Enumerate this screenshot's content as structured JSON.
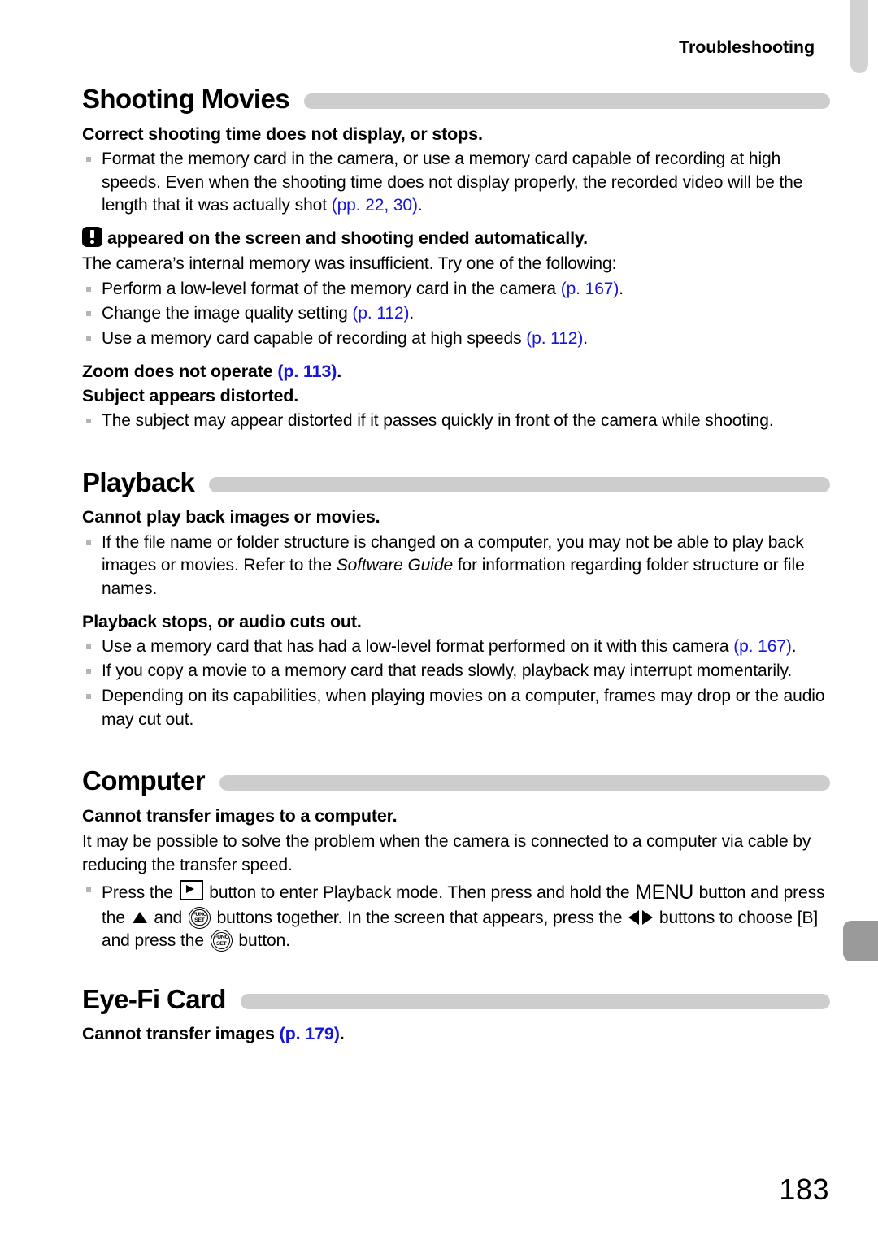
{
  "page": {
    "running_header": "Troubleshooting",
    "page_number": "183"
  },
  "sections": [
    {
      "title": "Shooting Movies",
      "blocks": [
        {
          "kind": "subhead",
          "text": "Correct shooting time does not display, or stops."
        },
        {
          "kind": "bullet",
          "text_before": "Format the memory card in the camera, or use a memory card capable of recording at high speeds. Even when the shooting time does not display properly, the recorded video will be the length that it was actually shot ",
          "ref": "(pp. 22, 30)",
          "text_after": "."
        },
        {
          "kind": "subhead_icon",
          "icon": "warning-icon",
          "text": "appeared on the screen and shooting ended automatically."
        },
        {
          "kind": "para",
          "text": "The camera’s internal memory was insufficient. Try one of the following:"
        },
        {
          "kind": "bullet",
          "text_before": "Perform a low-level format of the memory card in the camera ",
          "ref": "(p. 167)",
          "text_after": "."
        },
        {
          "kind": "bullet",
          "text_before": "Change the image quality setting ",
          "ref": "(p. 112)",
          "text_after": "."
        },
        {
          "kind": "bullet",
          "text_before": "Use a memory card capable of recording at high speeds ",
          "ref": "(p. 112)",
          "text_after": "."
        },
        {
          "kind": "subhead_ref",
          "text_before": "Zoom does not operate ",
          "ref": "(p. 113)",
          "text_after": "."
        },
        {
          "kind": "subhead_tight",
          "text": "Subject appears distorted."
        },
        {
          "kind": "bullet",
          "text_before": "The subject may appear distorted if it passes quickly in front of the camera while shooting.",
          "ref": "",
          "text_after": ""
        }
      ]
    },
    {
      "title": "Playback",
      "blocks": [
        {
          "kind": "subhead",
          "text": "Cannot play back images or movies."
        },
        {
          "kind": "bullet_italic",
          "text_before": "If the file name or folder structure is changed on a computer, you may not be able to play back images or movies. Refer to the ",
          "italic": "Software Guide",
          "text_after": " for information regarding folder structure or file names."
        },
        {
          "kind": "subhead",
          "text": "Playback stops, or audio cuts out."
        },
        {
          "kind": "bullet",
          "text_before": "Use a memory card that has had a low-level format performed on it with this camera ",
          "ref": "(p. 167)",
          "text_after": "."
        },
        {
          "kind": "bullet",
          "text_before": "If you copy a movie to a memory card that reads slowly, playback may interrupt momentarily.",
          "ref": "",
          "text_after": ""
        },
        {
          "kind": "bullet",
          "text_before": "Depending on its capabilities, when playing movies on a computer, frames may drop or the audio may cut out.",
          "ref": "",
          "text_after": ""
        }
      ]
    },
    {
      "title": "Computer",
      "blocks": [
        {
          "kind": "subhead",
          "text": "Cannot transfer images to a computer."
        },
        {
          "kind": "para",
          "text": "It may be possible to solve the problem when the camera is connected to a computer via cable by reducing the transfer speed."
        },
        {
          "kind": "bullet_buttons",
          "seg1": "Press the ",
          "icon1": "playback-button-icon",
          "seg2": " button to enter Playback mode. Then press and hold the ",
          "icon2": "menu-button-icon",
          "icon2_label": "MENU",
          "seg3": " button and press the ",
          "icon3": "up-arrow-icon",
          "seg4": " and ",
          "icon4": "func-set-button-icon",
          "icon4_label_top": "FUNC",
          "icon4_label_bottom": "SET",
          "seg5": " buttons together. In the screen that appears, press the ",
          "icon5": "left-right-arrow-icon",
          "seg6": " buttons to choose [B] and press the ",
          "icon6": "func-set-button-icon",
          "seg7": " button."
        }
      ]
    },
    {
      "title": "Eye-Fi Card",
      "blocks": [
        {
          "kind": "subhead_ref",
          "text_before": "Cannot transfer images ",
          "ref": "(p. 179)",
          "text_after": "."
        }
      ]
    }
  ],
  "colors": {
    "reference_link": "#1414dc",
    "heading_bar": "#cdcdcd",
    "bullet_marker": "#b4b4b4",
    "tab_top": "#d2d2d2",
    "tab_side": "#9a9a9a"
  }
}
